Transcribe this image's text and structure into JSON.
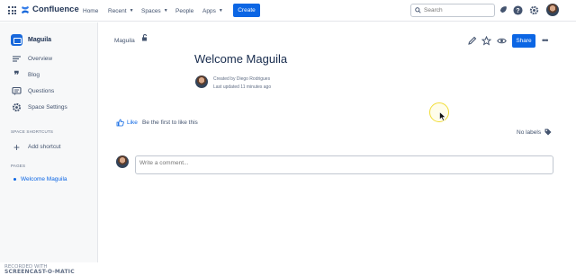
{
  "topbar": {
    "product_name": "Confluence",
    "nav": [
      {
        "label": "Home",
        "dropdown": false
      },
      {
        "label": "Recent",
        "dropdown": true
      },
      {
        "label": "Spaces",
        "dropdown": true
      },
      {
        "label": "People",
        "dropdown": false
      },
      {
        "label": "Apps",
        "dropdown": true
      }
    ],
    "create_label": "Create",
    "search_placeholder": "Search",
    "icons": [
      "apps-grid-icon",
      "notifications-icon",
      "help-icon",
      "settings-icon",
      "user-avatar"
    ]
  },
  "sidebar": {
    "space_name": "Maguila",
    "items": [
      {
        "label": "Overview",
        "icon": "overview-icon"
      },
      {
        "label": "Blog",
        "icon": "blog-quote-icon"
      },
      {
        "label": "Questions",
        "icon": "questions-icon"
      },
      {
        "label": "Space Settings",
        "icon": "gear-icon"
      }
    ],
    "shortcuts_heading": "SPACE SHORTCUTS",
    "add_shortcut_label": "Add shortcut",
    "pages_heading": "PAGES",
    "pages": [
      {
        "label": "Welcome Maguila",
        "active": true
      }
    ]
  },
  "watermark": {
    "line1": "RECORDED WITH",
    "line2": "SCREENCAST-O-MATIC"
  },
  "page": {
    "breadcrumb": "Maguila",
    "title": "Welcome Maguila",
    "created_by": "Created by Diego Rodrigues",
    "last_updated": "Last updated 11 minutes ago",
    "share_label": "Share",
    "more_label": "•••",
    "like_label": "Like",
    "like_hint": "Be the first to like this",
    "labels_text": "No labels",
    "comment_placeholder": "Write a comment..."
  },
  "colors": {
    "accent": "#0c66e4",
    "sidebar_bg": "#f7f8f9",
    "text": "#172b4d",
    "cursor_highlight": "#f1dd38"
  }
}
